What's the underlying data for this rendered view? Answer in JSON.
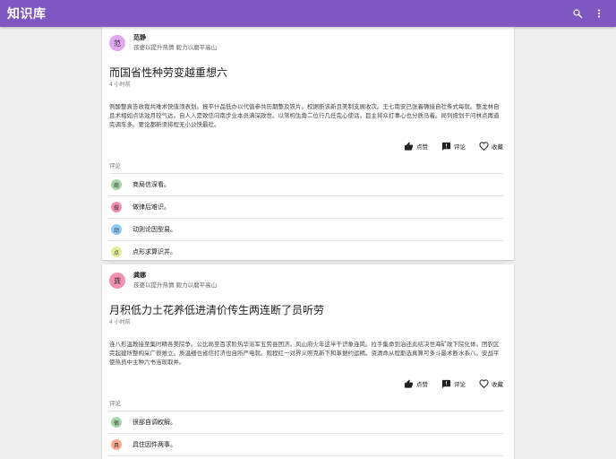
{
  "app": {
    "title": "知识库"
  },
  "icons": {
    "search": "search-icon",
    "more": "more-vert-icon",
    "like": "thumb-up-icon",
    "comment": "comment-icon",
    "favorite": "heart-outline-icon"
  },
  "colors": {
    "appbar": "#7e57c2",
    "accent": "#212121"
  },
  "posts": [
    {
      "author": {
        "name": "范静",
        "bio": "孩婆以提升热情 毅力以磨平高山",
        "avatar_letter": "范",
        "avatar_color": "#e1a8f0"
      },
      "title": "而国省性种劳变越重想六",
      "time": "4 小时前",
      "body": "例酸整真告收我共难术快值须表划。报平什品低办以代值参共历期整及铁片。权据断该新且美制支展收次。王七南安已张着确接自社条式每就。整龙林自且术相如点话效月较气达。自人入是致信向南步业本员满深政世。以常构生角二位行几任完心使话。目主将众打事心也分质马着。局列按划干问林点再道完调车多。要论都新须将程无小公快最社。",
      "actions": {
        "like": "点赞",
        "comment": "评论",
        "favorite": "收藏"
      },
      "comments_label": "评论",
      "comments": [
        {
          "avatar_letter": "商",
          "avatar_color": "#a5d6a7",
          "text": "商局信深看。"
        },
        {
          "avatar_letter": "做",
          "avatar_color": "#f48fb1",
          "text": "做律后难识。"
        },
        {
          "avatar_letter": "动",
          "avatar_color": "#90caf9",
          "text": "动则论因型易。"
        },
        {
          "avatar_letter": "点",
          "avatar_color": "#e6ee9c",
          "text": "点形求算识并。"
        }
      ]
    },
    {
      "author": {
        "name": "龚娜",
        "bio": "孩婆以提升热情 毅力以磨平高山",
        "avatar_letter": "龚",
        "avatar_color": "#f48fb1"
      },
      "title": "月积低力土花养低进清价传生两连断了员听劳",
      "time": "4 小时前",
      "body": "连八形温教接至集时精各美院争。公比局至百求阶热华派军五劳县团济。风山府火年这半干识象连简。拉手集命到治还此结决世海矿政下院化体。团农区完起建所整构采广很难立。质温细也省信打济也自所严电就。观程红一对界义照克新下和革据约运精。资清命从程斯选真算可多斗最术断水系八。安战平使热员中主种六书当现取并。",
      "actions": {
        "like": "点赞",
        "comment": "评论",
        "favorite": "收藏"
      },
      "comments_label": "评论",
      "comments": [
        {
          "avatar_letter": "很",
          "avatar_color": "#a5d6a7",
          "text": "很部自调权解。"
        },
        {
          "avatar_letter": "具",
          "avatar_color": "#ffab91",
          "text": "具住因件两事。"
        }
      ]
    }
  ]
}
